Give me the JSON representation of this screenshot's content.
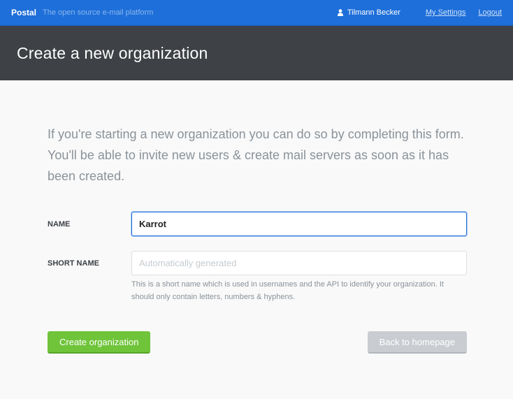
{
  "topbar": {
    "brand": "Postal",
    "tagline": "The open source e-mail platform",
    "user_icon": "user-icon",
    "user_name": "Tilmann Becker",
    "settings_link": "My Settings",
    "logout_link": "Logout"
  },
  "header": {
    "title": "Create a new organization"
  },
  "main": {
    "intro": "If you're starting a new organization you can do so by completing this form. You'll be able to invite new users & create mail servers as soon as it has been created.",
    "name_field": {
      "label": "Name",
      "value": "Karrot",
      "placeholder": ""
    },
    "short_name_field": {
      "label": "Short Name",
      "value": "",
      "placeholder": "Automatically generated",
      "hint": "This is a short name which is used in usernames and the API to identify your organization. It should only contain letters, numbers & hyphens."
    },
    "create_button": "Create organization",
    "back_button": "Back to homepage"
  },
  "colors": {
    "topbar": "#1e6fd9",
    "title_bar": "#3e4145",
    "primary_button": "#6fc43a",
    "secondary_button": "#c9cdd1"
  }
}
